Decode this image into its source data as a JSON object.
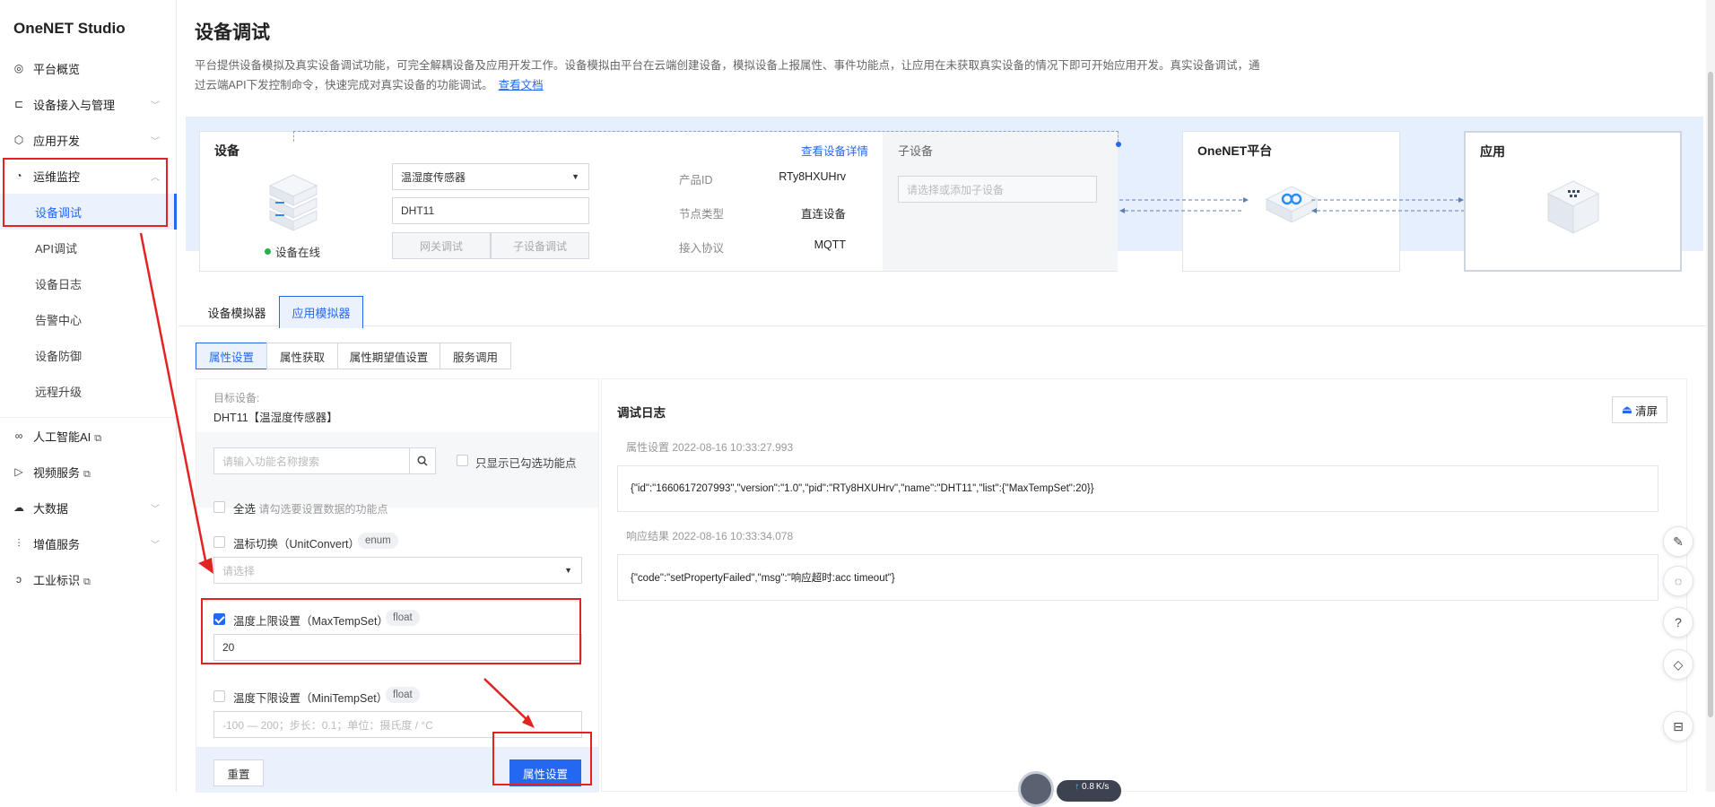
{
  "sidebar": {
    "brand": "OneNET Studio",
    "items": [
      {
        "label": "平台概览",
        "icon": "compass-icon"
      },
      {
        "label": "设备接入与管理",
        "icon": "device-icon"
      },
      {
        "label": "应用开发",
        "icon": "cube-icon"
      },
      {
        "label": "运维监控",
        "icon": "clock-icon"
      },
      {
        "label": "人工智能AI",
        "icon": "link-icon"
      },
      {
        "label": "视频服务",
        "icon": "video-icon"
      },
      {
        "label": "大数据",
        "icon": "cloud-icon"
      },
      {
        "label": "增值服务",
        "icon": "chart-icon"
      },
      {
        "label": "工业标识",
        "icon": "id-icon"
      }
    ],
    "subitems": [
      "设备调试",
      "API调试",
      "设备日志",
      "告警中心",
      "设备防御",
      "远程升级"
    ]
  },
  "header": {
    "title": "设备调试",
    "desc_line1": "平台提供设备模拟及真实设备调试功能，可完全解耦设备及应用开发工作。设备模拟由平台在云端创建设备，模拟设备上报属性、事件功能点，让应用在未获取真实设备的情况下即可开始应用开发。真实设备调试，通",
    "desc_line2": "过云端API下发控制命令，快速完成对真实设备的功能调试。",
    "doc_link": "查看文档"
  },
  "device": {
    "title": "设备",
    "detail_link": "查看设备详情",
    "product_select": "温湿度传感器",
    "device_name": "DHT11",
    "gateway_btn": "网关调试",
    "subdevice_btn": "子设备调试",
    "status": "设备在线",
    "status_color": "#27b148",
    "product_id_label": "产品ID",
    "product_id": "RTy8HXUHrv",
    "node_type_label": "节点类型",
    "node_type": "直连设备",
    "protocol_label": "接入协议",
    "protocol": "MQTT"
  },
  "subdevice": {
    "title": "子设备",
    "placeholder": "请选择或添加子设备"
  },
  "platform": {
    "title": "OneNET平台"
  },
  "application": {
    "title": "应用"
  },
  "tabs": [
    "设备模拟器",
    "应用模拟器"
  ],
  "subtabs": [
    "属性设置",
    "属性获取",
    "属性期望值设置",
    "服务调用"
  ],
  "target": {
    "label": "目标设备:",
    "value": "DHT11【温湿度传感器】"
  },
  "search": {
    "placeholder": "请输入功能名称搜索",
    "only_checked": "只显示已勾选功能点"
  },
  "select_all": {
    "label": "全选",
    "hint": "请勾选要设置数据的功能点"
  },
  "props": [
    {
      "label": "温标切换（UnitConvert）",
      "type": "enum",
      "placeholder": "请选择",
      "checked": false
    },
    {
      "label": "温度上限设置（MaxTempSet）",
      "type": "float",
      "value": "20",
      "checked": true
    },
    {
      "label": "温度下限设置（MiniTempSet）",
      "type": "float",
      "placeholder": "-100 — 200；步长：0.1；单位：摄氏度 / °C",
      "checked": false
    }
  ],
  "buttons": {
    "reset": "重置",
    "submit": "属性设置"
  },
  "log": {
    "title": "调试日志",
    "clear": "清屏",
    "entries": [
      {
        "header": "属性设置 2022-08-16 10:33:27.993",
        "body": "{\"id\":\"1660617207993\",\"version\":\"1.0\",\"pid\":\"RTy8HXUHrv\",\"name\":\"DHT11\",\"list\":{\"MaxTempSet\":20}}"
      },
      {
        "header": "响应结果 2022-08-16 10:33:34.078",
        "body": "{\"code\":\"setPropertyFailed\",\"msg\":\"响应超时:acc timeout\"}"
      }
    ]
  },
  "network": {
    "speed": "0.8",
    "unit": "K/s"
  },
  "colors": {
    "accent": "#2468f2",
    "annotation": "#e32222"
  }
}
